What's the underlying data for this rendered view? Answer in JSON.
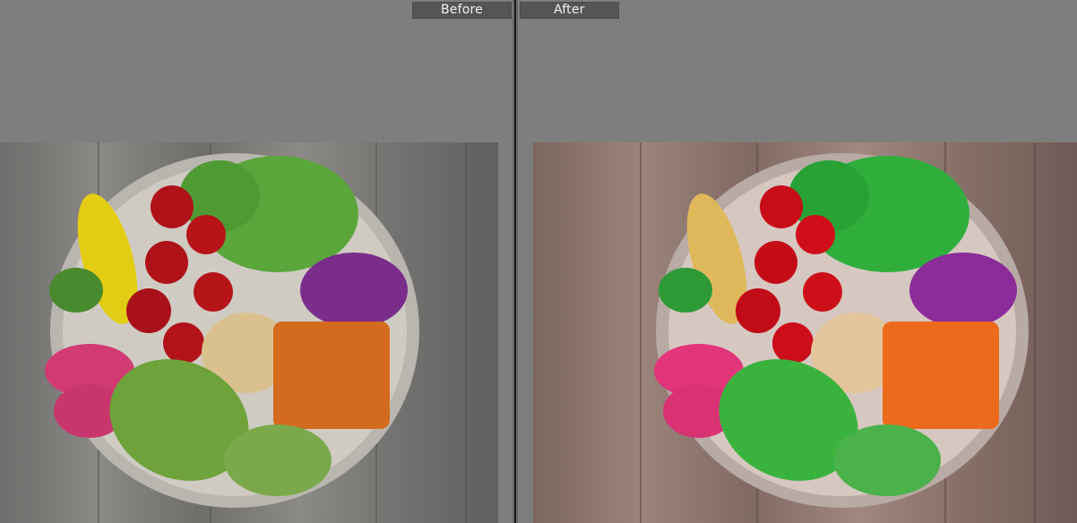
{
  "compare": {
    "before_label": "Before",
    "after_label": "After"
  },
  "colors": {
    "panel_bg": "#7e7e7e",
    "label_bg": "#555555",
    "label_text": "#f0f0f0",
    "divider": "#1a1a1a"
  },
  "images": {
    "before_description": "salad-bowl-photo-original",
    "after_description": "salad-bowl-photo-edited"
  }
}
